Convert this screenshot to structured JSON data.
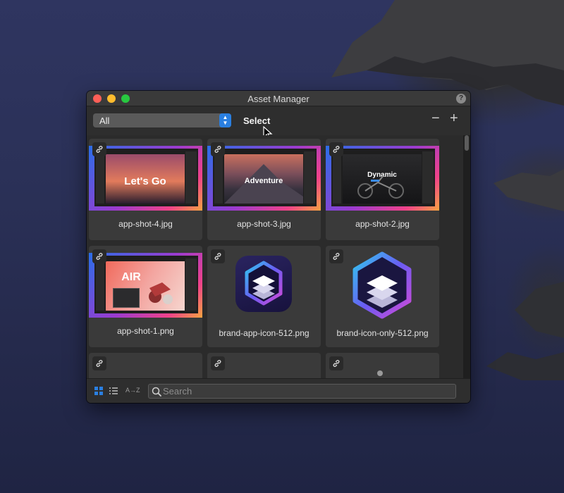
{
  "window": {
    "title": "Asset Manager",
    "help_label": "?"
  },
  "toolbar": {
    "filter_value": "All",
    "select_label": "Select",
    "zoom_out_label": "−",
    "zoom_in_label": "+"
  },
  "assets": [
    {
      "name": "app-shot-4.jpg",
      "preview_text": "Let's Go",
      "kind": "screenshot"
    },
    {
      "name": "app-shot-3.jpg",
      "preview_text": "Adventure",
      "kind": "screenshot"
    },
    {
      "name": "app-shot-2.jpg",
      "preview_text": "Dynamic",
      "kind": "screenshot"
    },
    {
      "name": "app-shot-1.png",
      "preview_text": "AIR",
      "kind": "screenshot"
    },
    {
      "name": "brand-app-icon-512.png",
      "kind": "icon"
    },
    {
      "name": "brand-icon-only-512.png",
      "kind": "icon"
    }
  ],
  "bottom_bar": {
    "sort_label": "A→Z",
    "search_placeholder": "Search"
  },
  "icons": [
    "link-icon",
    "grid-view-icon",
    "list-view-icon",
    "search-icon",
    "pointer-cursor-icon"
  ],
  "colors": {
    "accent": "#2a7fe0",
    "window_bg": "#2b2b2b",
    "tile_bg": "#3a3a3a"
  }
}
